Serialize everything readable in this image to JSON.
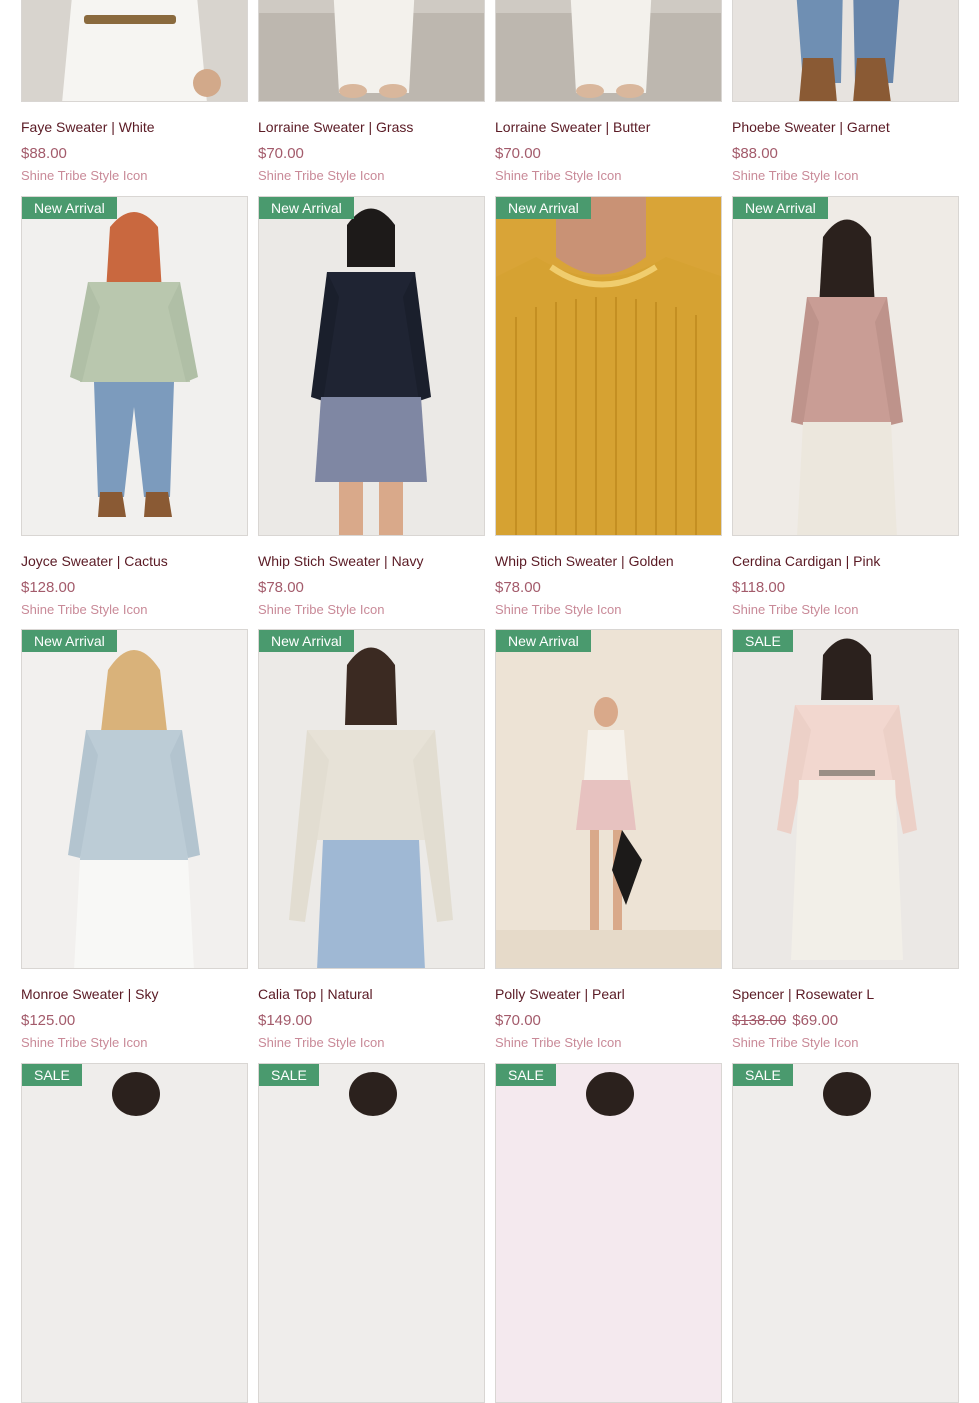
{
  "colors": {
    "title": "#5a1a24",
    "price": "#a35b6b",
    "brand": "#c98a98",
    "badge_new": "#4a9a6e",
    "badge_sale": "#4a9a6e"
  },
  "rows": [
    {
      "products": [
        {
          "title": "Faye Sweater | White",
          "price": "$88.00",
          "brand": "Shine Tribe Style Icon",
          "image_icon": "product-photo"
        },
        {
          "title": "Lorraine Sweater | Grass",
          "price": "$70.00",
          "brand": "Shine Tribe Style Icon",
          "image_icon": "product-photo"
        },
        {
          "title": "Lorraine Sweater | Butter",
          "price": "$70.00",
          "brand": "Shine Tribe Style Icon",
          "image_icon": "product-photo"
        },
        {
          "title": "Phoebe Sweater | Garnet",
          "price": "$88.00",
          "brand": "Shine Tribe Style Icon",
          "image_icon": "product-photo"
        }
      ]
    },
    {
      "products": [
        {
          "badge": "New Arrival",
          "title": "Joyce Sweater | Cactus",
          "price": "$128.00",
          "brand": "Shine Tribe Style Icon",
          "image_icon": "product-photo"
        },
        {
          "badge": "New Arrival",
          "title": "Whip Stich Sweater | Navy",
          "price": "$78.00",
          "brand": "Shine Tribe Style Icon",
          "image_icon": "product-photo"
        },
        {
          "badge": "New Arrival",
          "title": "Whip Stich Sweater | Golden",
          "price": "$78.00",
          "brand": "Shine Tribe Style Icon",
          "image_icon": "product-photo"
        },
        {
          "badge": "New Arrival",
          "title": "Cerdina Cardigan | Pink",
          "price": "$118.00",
          "brand": "Shine Tribe Style Icon",
          "image_icon": "product-photo"
        }
      ]
    },
    {
      "products": [
        {
          "badge": "New Arrival",
          "title": "Monroe Sweater | Sky",
          "price": "$125.00",
          "brand": "Shine Tribe Style Icon",
          "image_icon": "product-photo"
        },
        {
          "badge": "New Arrival",
          "title": "Calia Top | Natural",
          "price": "$149.00",
          "brand": "Shine Tribe Style Icon",
          "image_icon": "product-photo"
        },
        {
          "badge": "New Arrival",
          "title": "Polly Sweater | Pearl",
          "price": "$70.00",
          "brand": "Shine Tribe Style Icon",
          "image_icon": "product-photo"
        },
        {
          "badge": "SALE",
          "title": "Spencer | Rosewater L",
          "old_price": "$138.00",
          "price": "$69.00",
          "brand": "Shine Tribe Style Icon",
          "image_icon": "product-photo"
        }
      ]
    },
    {
      "products": [
        {
          "badge": "SALE",
          "image_icon": "product-photo"
        },
        {
          "badge": "SALE",
          "image_icon": "product-photo"
        },
        {
          "badge": "SALE",
          "image_icon": "product-photo"
        },
        {
          "badge": "SALE",
          "image_icon": "product-photo"
        }
      ]
    }
  ]
}
